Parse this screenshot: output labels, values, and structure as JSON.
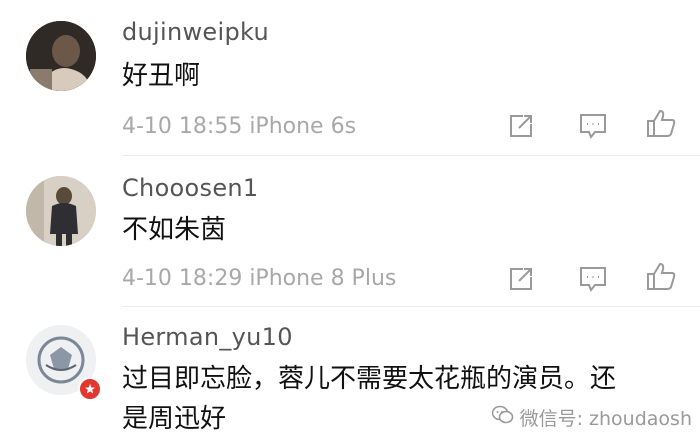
{
  "comments": [
    {
      "username": "dujinweipku",
      "text": "好丑啊",
      "meta": "4-10 18:55 iPhone 6s"
    },
    {
      "username": "Chooosen1",
      "text": "不如朱茵",
      "meta": "4-10 18:29 iPhone 8 Plus"
    },
    {
      "username": "Herman_yu10",
      "text_line1": "过目即忘脸，蓉儿不需要太花瓶的演员。还",
      "text_line2": "是周迅好"
    }
  ],
  "watermark": "微信号: zhoudaosh",
  "colors": {
    "username": "#555555",
    "meta": "#a8a8a8",
    "icon": "#9a9a9a",
    "badge": "#e0382f"
  },
  "icons": [
    "share-icon",
    "comment-icon",
    "like-icon",
    "wechat-icon",
    "verified-badge-icon"
  ]
}
